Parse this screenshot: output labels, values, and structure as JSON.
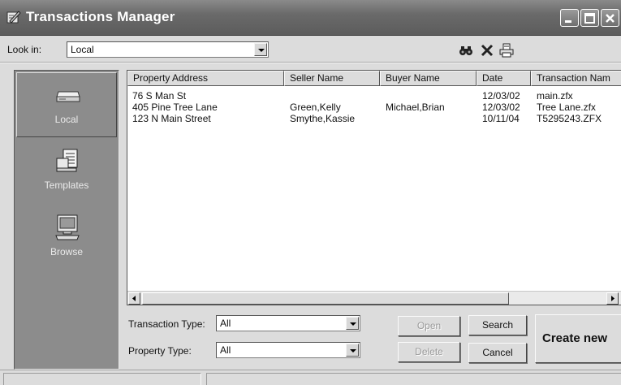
{
  "window": {
    "title": "Transactions Manager"
  },
  "lookin": {
    "label": "Look in:",
    "value": "Local"
  },
  "toolbar": {
    "icons": [
      "find-icon",
      "delete-icon",
      "print-icon"
    ]
  },
  "nav": {
    "items": [
      {
        "label": "Local",
        "icon": "drive-icon",
        "selected": true
      },
      {
        "label": "Templates",
        "icon": "templates-icon",
        "selected": false
      },
      {
        "label": "Browse",
        "icon": "computer-icon",
        "selected": false
      }
    ]
  },
  "list": {
    "columns": [
      "Property Address",
      "Seller Name",
      "Buyer Name",
      "Date",
      "Transaction Nam"
    ],
    "rows": [
      {
        "address": "76 S Man St",
        "seller": "",
        "buyer": "",
        "date": "12/03/02",
        "transaction": "main.zfx"
      },
      {
        "address": "405 Pine Tree Lane",
        "seller": "Green,Kelly",
        "buyer": "Michael,Brian",
        "date": "12/03/02",
        "transaction": "Tree Lane.zfx"
      },
      {
        "address": "123 N Main Street",
        "seller": "Smythe,Kassie",
        "buyer": "",
        "date": "10/11/04",
        "transaction": "T5295243.ZFX"
      }
    ]
  },
  "filters": {
    "transaction_type": {
      "label": "Transaction Type:",
      "value": "All"
    },
    "property_type": {
      "label": "Property Type:",
      "value": "All"
    }
  },
  "buttons": {
    "open": "Open",
    "delete": "Delete",
    "search": "Search",
    "cancel": "Cancel",
    "create_new": "Create new"
  }
}
